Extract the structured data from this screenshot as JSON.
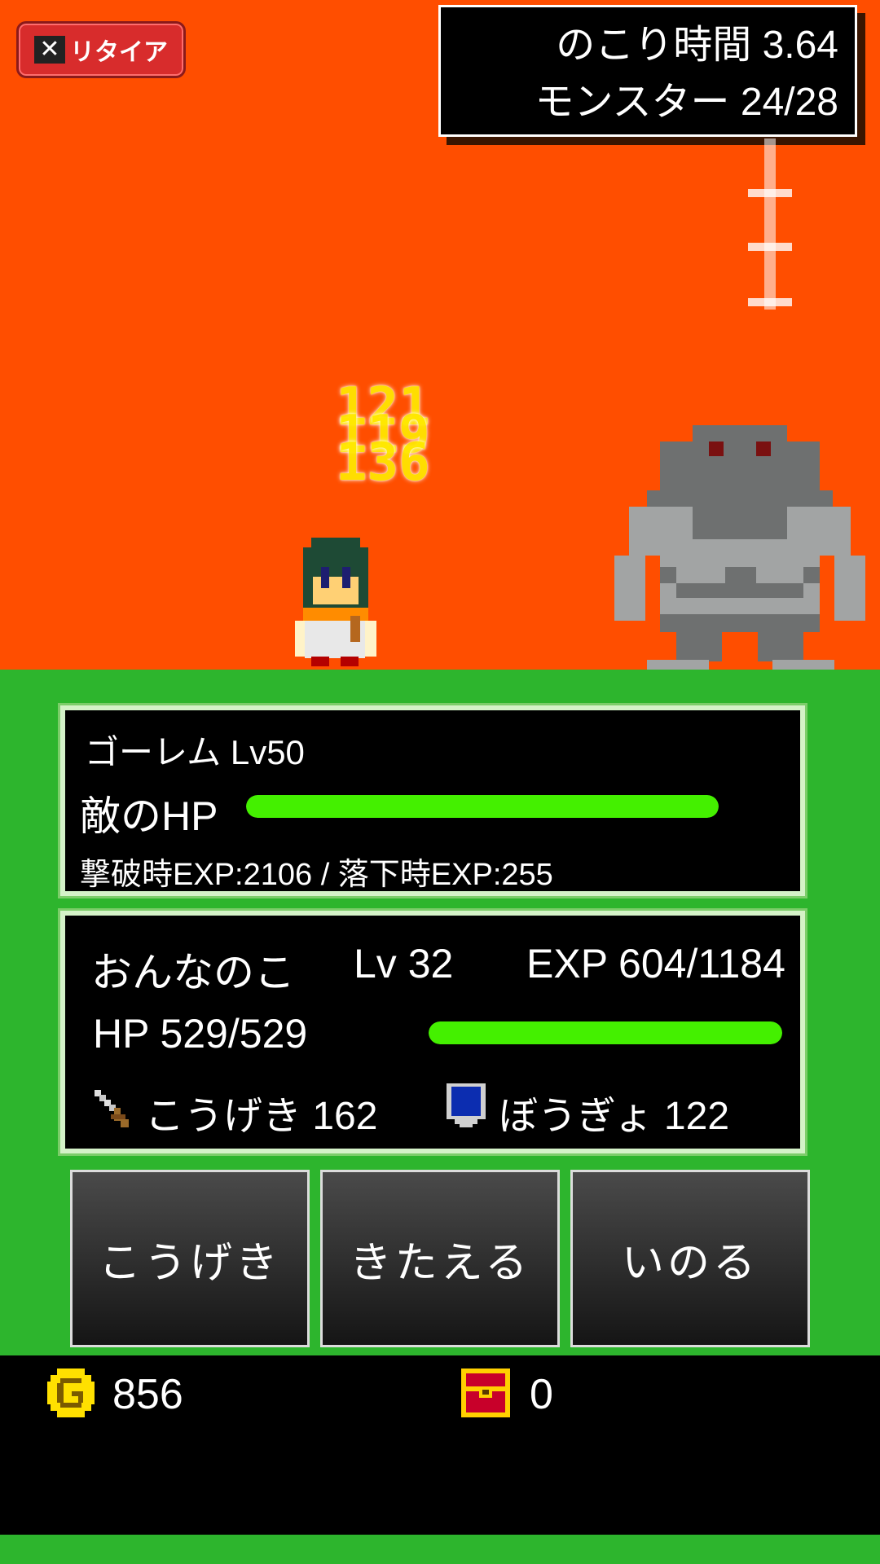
{
  "header": {
    "retire_label": "リタイア",
    "retire_x": "✕",
    "time_remaining": "のこり時間 3.64",
    "monsters": "モンスター 24/28"
  },
  "battle": {
    "damage_numbers": [
      "121",
      "119",
      "136"
    ]
  },
  "enemy": {
    "name": "ゴーレム Lv50",
    "hp_label": "敵のHP",
    "hp_fraction": 1.0,
    "exp_info": "撃破時EXP:2106 / 落下時EXP:255"
  },
  "player": {
    "name": "おんなのこ",
    "level": "Lv 32",
    "exp": "EXP 604/1184",
    "hp": "HP 529/529",
    "hp_fraction": 1.0,
    "attack": "こうげき 162",
    "defense": "ぼうぎょ 122"
  },
  "commands": {
    "attack": "こうげき",
    "train": "きたえる",
    "pray": "いのる"
  },
  "footer": {
    "gold": "856",
    "chests": "0"
  },
  "colors": {
    "sky": "#ff4e00",
    "ground": "#2db52d",
    "hp_bar": "#44f000"
  }
}
